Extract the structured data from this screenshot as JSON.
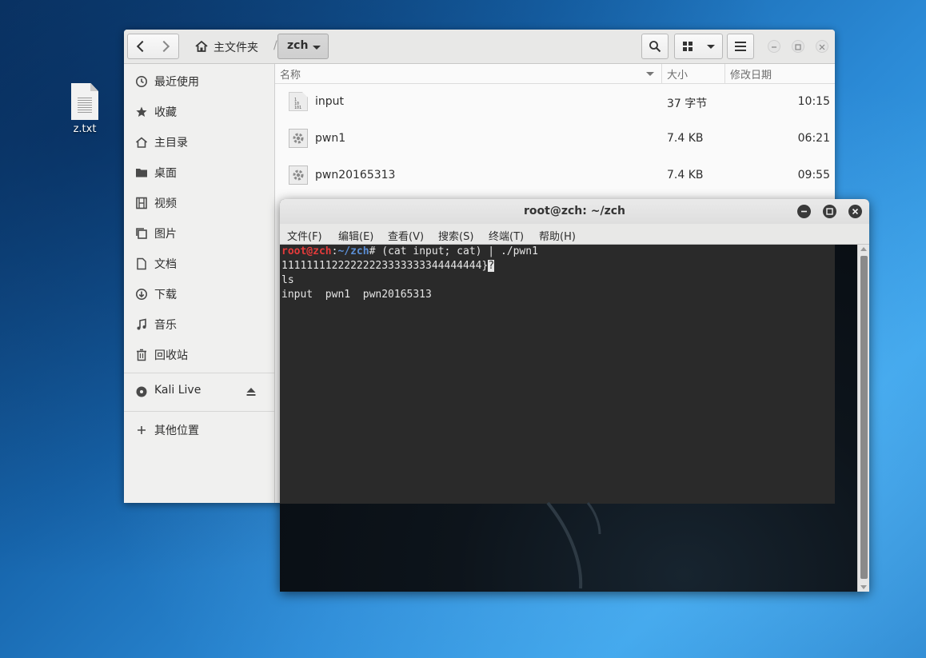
{
  "desktop": {
    "file_icon_label": "z.txt"
  },
  "file_manager": {
    "breadcrumb_home": "主文件夹",
    "breadcrumb_separator": "/",
    "breadcrumb_current": "zch",
    "sidebar": {
      "items": [
        {
          "label": "最近使用",
          "icon": "clock-icon"
        },
        {
          "label": "收藏",
          "icon": "star-icon"
        },
        {
          "label": "主目录",
          "icon": "home-icon"
        },
        {
          "label": "桌面",
          "icon": "folder-icon"
        },
        {
          "label": "视频",
          "icon": "film-icon"
        },
        {
          "label": "图片",
          "icon": "image-icon"
        },
        {
          "label": "文档",
          "icon": "document-icon"
        },
        {
          "label": "下载",
          "icon": "download-icon"
        },
        {
          "label": "音乐",
          "icon": "music-icon"
        },
        {
          "label": "回收站",
          "icon": "trash-icon"
        }
      ],
      "devices": [
        {
          "label": "Kali Live",
          "icon": "disc-icon"
        }
      ],
      "other_locations": "其他位置"
    },
    "columns": {
      "name": "名称",
      "size": "大小",
      "modified": "修改日期"
    },
    "files": [
      {
        "name": "input",
        "size": "37 字节",
        "modified": "10:15",
        "icon": "binary-file-icon"
      },
      {
        "name": "pwn1",
        "size": "7.4 KB",
        "modified": "06:21",
        "icon": "executable-icon"
      },
      {
        "name": "pwn20165313",
        "size": "7.4 KB",
        "modified": "09:55",
        "icon": "executable-icon"
      }
    ]
  },
  "terminal": {
    "title": "root@zch: ~/zch",
    "menu": [
      "文件(F)",
      "编辑(E)",
      "查看(V)",
      "搜索(S)",
      "终端(T)",
      "帮助(H)"
    ],
    "prompt_user": "root@zch",
    "prompt_colon": ":",
    "prompt_path": "~/zch",
    "prompt_hash": "#",
    "command": " (cat input; cat) | ./pwn1",
    "output_line1": "11111111222222223333333344444444}",
    "output_glyph": "?",
    "line_ls": "ls",
    "ls_output": "input  pwn1  pwn20165313"
  },
  "colors": {
    "prompt_user": "#e43b3b",
    "prompt_path": "#5b8fd6"
  }
}
